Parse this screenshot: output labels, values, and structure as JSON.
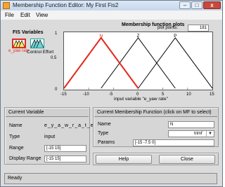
{
  "window": {
    "title": "Membership Function Editor: My First Fis2",
    "minimize_glyph": "–",
    "maximize_glyph": "□",
    "close_glyph": "x"
  },
  "menu": [
    "File",
    "Edit",
    "View"
  ],
  "fis_variables": {
    "title": "FIS Variables",
    "input_label": "e_yaw rate",
    "output_label": "Control Effort"
  },
  "plot": {
    "title": "Membership function plots",
    "plot_points_label": "plot points:",
    "plot_points_value": "181",
    "xlabel": "input variable \"e_yaw rate\"",
    "y_tick_1": "1",
    "y_tick_0_5": "0.5",
    "y_tick_0": "0",
    "x_ticks": [
      "-15",
      "-10",
      "-5",
      "0",
      "5",
      "10",
      "15"
    ],
    "mf_labels": [
      "N",
      "Z",
      "P"
    ]
  },
  "chart_data": {
    "type": "line",
    "xlabel": "input variable \"e_yaw rate\"",
    "ylabel": "",
    "xlim": [
      -15,
      15
    ],
    "ylim": [
      0,
      1
    ],
    "series": [
      {
        "name": "N",
        "x": [
          -15,
          -7.5,
          0
        ],
        "y": [
          0,
          1,
          0
        ],
        "color": "#e32b1e"
      },
      {
        "name": "Z",
        "x": [
          -7.5,
          0,
          7.5
        ],
        "y": [
          0,
          1,
          0
        ],
        "color": "#000000"
      },
      {
        "name": "P",
        "x": [
          0,
          7.5,
          15
        ],
        "y": [
          0,
          1,
          0
        ],
        "color": "#000000"
      }
    ]
  },
  "current_variable": {
    "header": "Current Variable",
    "name_label": "Name",
    "name_value": "e_y_a_w_r_a_t_e",
    "type_label": "Type",
    "type_value": "input",
    "range_label": "Range",
    "range_value": "[-15 15]",
    "display_range_label": "Display Range",
    "display_range_value": "[-15 15]"
  },
  "current_mf": {
    "header": "Current Membership Function (click on MF to select)",
    "name_label": "Name",
    "name_value": "N",
    "type_label": "Type",
    "type_value": "trimf",
    "params_label": "Params",
    "params_value": "[-15 -7.5 0]"
  },
  "buttons": {
    "help": "Help",
    "close": "Close"
  },
  "status": "Ready"
}
